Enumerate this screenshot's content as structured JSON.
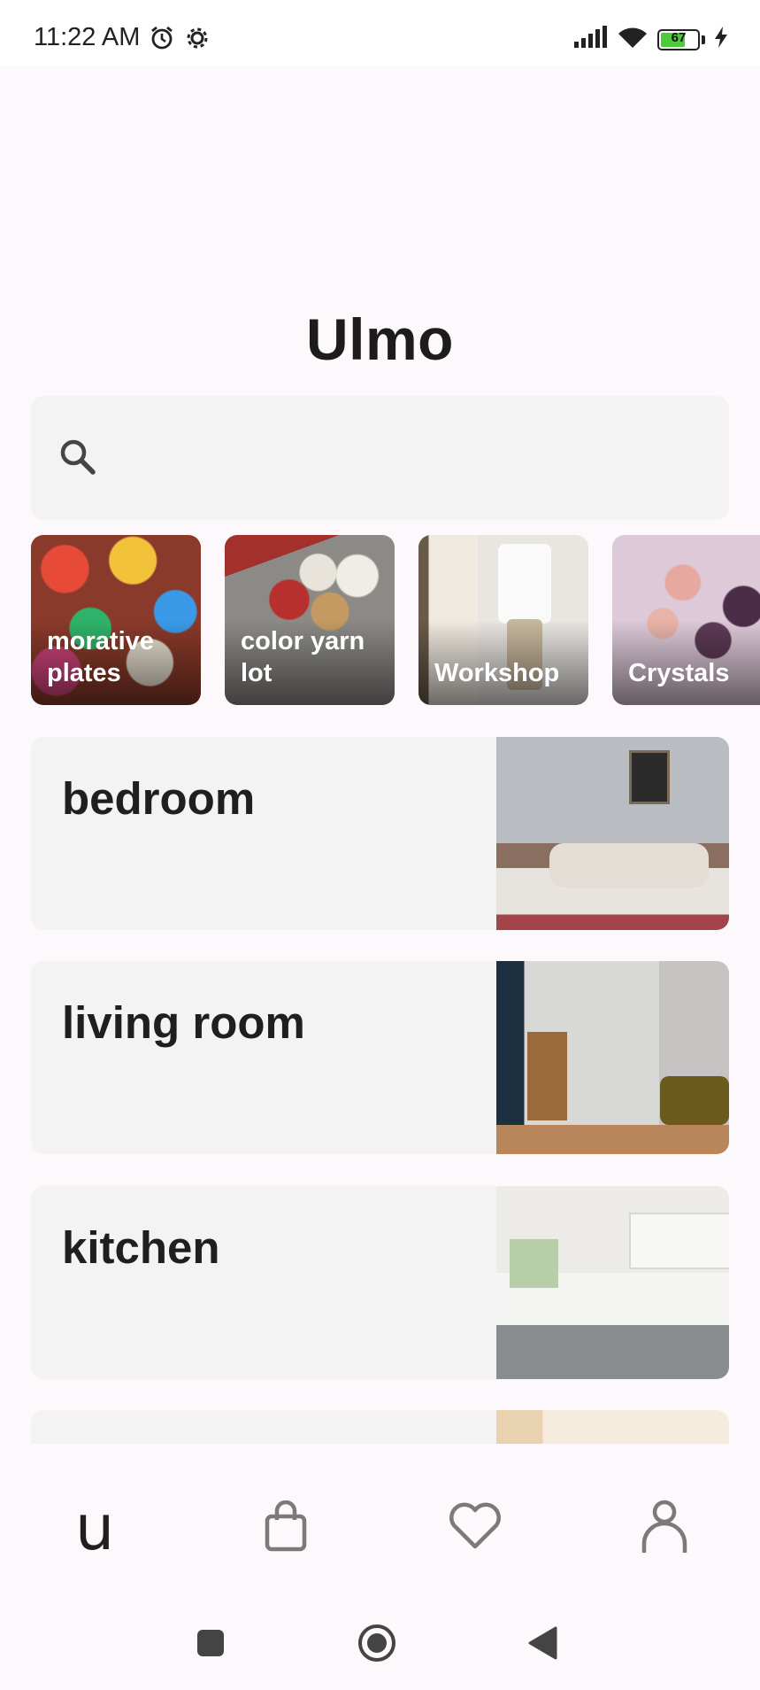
{
  "status_bar": {
    "time": "11:22 AM",
    "battery_level": "67",
    "battery_fraction": 0.67,
    "icons": [
      "alarm-icon",
      "settings-gear-icon",
      "signal-icon",
      "wifi-icon",
      "battery-icon",
      "charging-icon"
    ]
  },
  "app": {
    "title": "Ulmo"
  },
  "search": {
    "icon": "search-icon",
    "value": ""
  },
  "categories": [
    {
      "label": "morative plates"
    },
    {
      "label": "color yarn lot"
    },
    {
      "label": "Workshop"
    },
    {
      "label": "Crystals"
    }
  ],
  "rooms": [
    {
      "label": "bedroom"
    },
    {
      "label": "living room"
    },
    {
      "label": "kitchen"
    },
    {
      "label": ""
    }
  ],
  "bottom_nav": {
    "items": [
      {
        "name": "home",
        "glyph": "u",
        "active": true
      },
      {
        "name": "bag",
        "icon": "shopping-bag-icon"
      },
      {
        "name": "favorites",
        "icon": "heart-icon"
      },
      {
        "name": "profile",
        "icon": "person-icon"
      }
    ]
  },
  "system_nav": {
    "icons": [
      "recents-square-icon",
      "home-circle-icon",
      "back-triangle-icon"
    ]
  },
  "colors": {
    "background": "#fdf8fb",
    "card": "#f3f3f3",
    "text": "#1f1f1f",
    "battery": "#4ecb3a"
  }
}
